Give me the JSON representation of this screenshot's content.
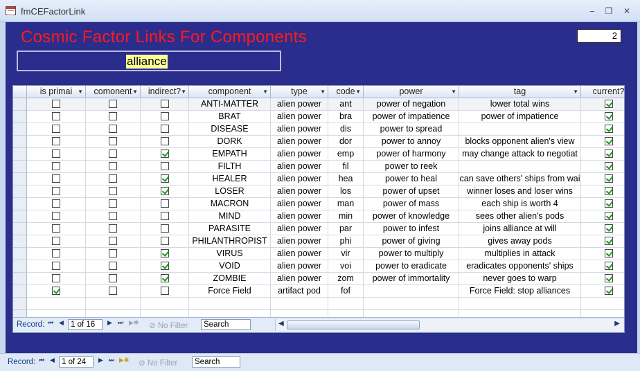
{
  "window": {
    "title": "fmCEFactorLink",
    "minimize": "‒",
    "restore": "❐",
    "close": "✕"
  },
  "form": {
    "title": "Cosmic Factor Links For Components",
    "count": "2",
    "search_value": "alliance"
  },
  "grid": {
    "columns": [
      {
        "label": "is primai"
      },
      {
        "label": "comonent"
      },
      {
        "label": "indirect?"
      },
      {
        "label": "component"
      },
      {
        "label": "type"
      },
      {
        "label": "code"
      },
      {
        "label": "power"
      },
      {
        "label": "tag"
      },
      {
        "label": "current?"
      }
    ],
    "rows": [
      {
        "is_primary": false,
        "comonent": false,
        "indirect": false,
        "component": "ANTI-MATTER",
        "type": "alien power",
        "code": "ant",
        "power": "power of negation",
        "tag": "lower total wins",
        "current": true
      },
      {
        "is_primary": false,
        "comonent": false,
        "indirect": false,
        "component": "BRAT",
        "type": "alien power",
        "code": "bra",
        "power": "power of impatience",
        "tag": "power of impatience",
        "current": true
      },
      {
        "is_primary": false,
        "comonent": false,
        "indirect": false,
        "component": "DISEASE",
        "type": "alien power",
        "code": "dis",
        "power": "power to spread",
        "tag": "",
        "current": true
      },
      {
        "is_primary": false,
        "comonent": false,
        "indirect": false,
        "component": "DORK",
        "type": "alien power",
        "code": "dor",
        "power": "power to annoy",
        "tag": "blocks opponent alien's view",
        "current": true
      },
      {
        "is_primary": false,
        "comonent": false,
        "indirect": true,
        "component": "EMPATH",
        "type": "alien power",
        "code": "emp",
        "power": "power of harmony",
        "tag": "may change attack to negotiat",
        "current": true
      },
      {
        "is_primary": false,
        "comonent": false,
        "indirect": false,
        "component": "FILTH",
        "type": "alien power",
        "code": "fil",
        "power": "power to reek",
        "tag": "",
        "current": true
      },
      {
        "is_primary": false,
        "comonent": false,
        "indirect": true,
        "component": "HEALER",
        "type": "alien power",
        "code": "hea",
        "power": "power to heal",
        "tag": "can save others' ships from wai",
        "current": true
      },
      {
        "is_primary": false,
        "comonent": false,
        "indirect": true,
        "component": "LOSER",
        "type": "alien power",
        "code": "los",
        "power": "power of upset",
        "tag": "winner loses and loser wins",
        "current": true
      },
      {
        "is_primary": false,
        "comonent": false,
        "indirect": false,
        "component": "MACRON",
        "type": "alien power",
        "code": "man",
        "power": "power of mass",
        "tag": "each ship is worth 4",
        "current": true
      },
      {
        "is_primary": false,
        "comonent": false,
        "indirect": false,
        "component": "MIND",
        "type": "alien power",
        "code": "min",
        "power": "power of knowledge",
        "tag": "sees other alien's pods",
        "current": true
      },
      {
        "is_primary": false,
        "comonent": false,
        "indirect": false,
        "component": "PARASITE",
        "type": "alien power",
        "code": "par",
        "power": "power to infest",
        "tag": "joins alliance at will",
        "current": true
      },
      {
        "is_primary": false,
        "comonent": false,
        "indirect": false,
        "component": "PHILANTHROPIST",
        "type": "alien power",
        "code": "phi",
        "power": "power of giving",
        "tag": "gives away pods",
        "current": true
      },
      {
        "is_primary": false,
        "comonent": false,
        "indirect": true,
        "component": "VIRUS",
        "type": "alien power",
        "code": "vir",
        "power": "power to multiply",
        "tag": "multiplies in attack",
        "current": true
      },
      {
        "is_primary": false,
        "comonent": false,
        "indirect": true,
        "component": "VOID",
        "type": "alien power",
        "code": "voi",
        "power": "power to eradicate",
        "tag": "eradicates opponents' ships",
        "current": true
      },
      {
        "is_primary": false,
        "comonent": false,
        "indirect": true,
        "component": "ZOMBIE",
        "type": "alien power",
        "code": "zom",
        "power": "power of immortality",
        "tag": "never goes to warp",
        "current": true
      },
      {
        "is_primary": true,
        "comonent": false,
        "indirect": false,
        "component": "Force Field",
        "type": "artifact pod",
        "code": "fof",
        "power": "",
        "tag": "Force Field: stop alliances",
        "current": true
      }
    ]
  },
  "subform_nav": {
    "record_label": "Record:",
    "position": "1 of 16",
    "filter_label": "No Filter",
    "search_placeholder": "Search",
    "first": "⏮",
    "prev": "◀",
    "next": "▶",
    "last": "⏭",
    "new": "▶✱"
  },
  "main_nav": {
    "record_label": "Record:",
    "position": "1 of 24",
    "filter_label": "No Filter",
    "search_placeholder": "Search",
    "first": "⏮",
    "prev": "◀",
    "next": "▶",
    "last": "⏭",
    "new": "▶✱"
  }
}
